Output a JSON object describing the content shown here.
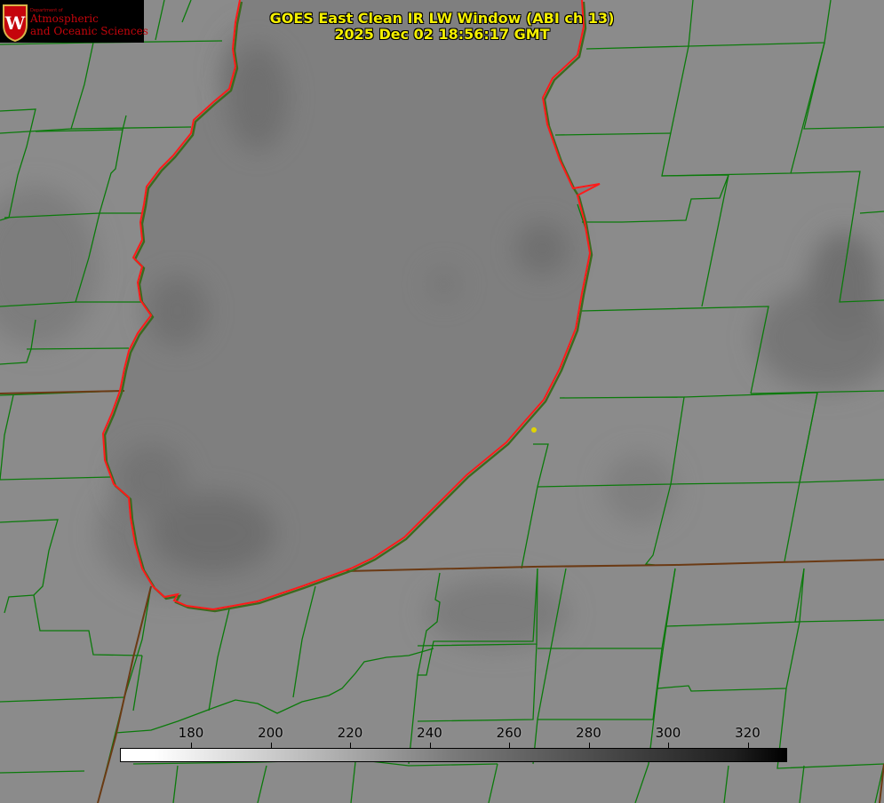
{
  "title_line1": "GOES East Clean IR LW Window (ABI ch 13)",
  "title_line2": "2025 Dec 02 18:56:17 GMT",
  "logo": {
    "dept": "Department of",
    "line1": "Atmospheric",
    "line2": "and Oceanic Sciences",
    "emblem_letter": "W"
  },
  "colorbar": {
    "ticks": [
      "180",
      "200",
      "220",
      "240",
      "260",
      "280",
      "300",
      "320"
    ]
  },
  "colors": {
    "background": "#8a8a8a",
    "lake": "#7e7e7e",
    "county_lines": "#0b7a0b",
    "shoreline": "#ff1a1a",
    "title": "#f5f000",
    "marker": "#e0d400"
  }
}
